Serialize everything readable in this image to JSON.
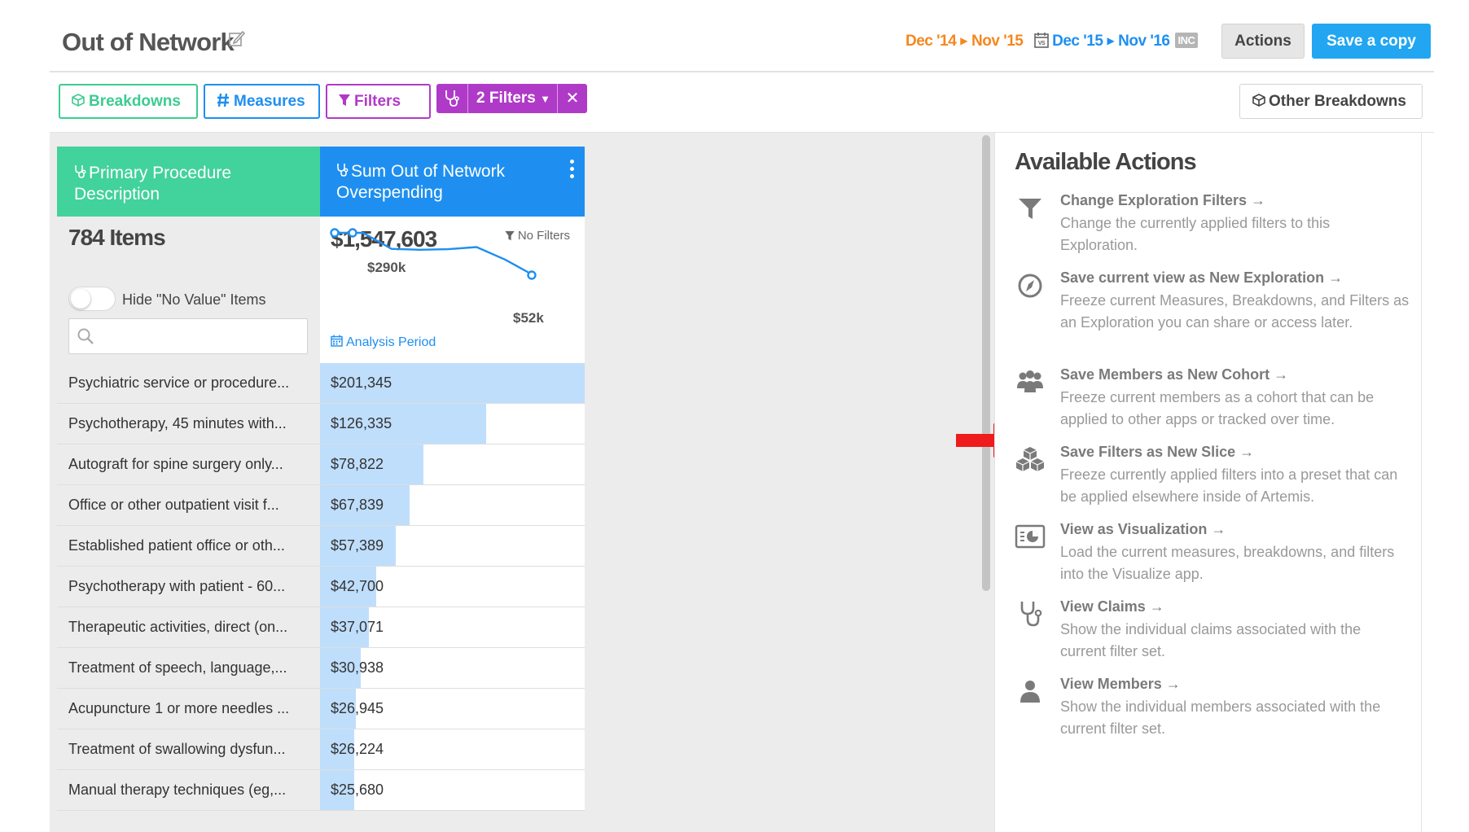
{
  "header": {
    "title": "Out of Network",
    "date_range_1": {
      "start": "Dec '14",
      "end": "Nov '15"
    },
    "date_range_2": {
      "start": "Dec '15",
      "end": "Nov '16"
    },
    "inc_badge": "INC",
    "actions_label": "Actions",
    "save_copy_label": "Save a copy"
  },
  "toolbar": {
    "breakdowns_label": "Breakdowns",
    "measures_label": "Measures",
    "filters_label": "Filters",
    "filter_count_label": "2 Filters",
    "close_glyph": "✕",
    "other_breakdowns_label": "Other Breakdowns"
  },
  "table": {
    "col1_header": "Primary Procedure Description",
    "col2_header": "Sum Out of Network Overspending",
    "items_count": "784 Items",
    "hide_no_value_label": "Hide \"No Value\" Items",
    "search_placeholder": "",
    "total": "$1,547,603",
    "no_filters_label": "No Filters",
    "spark_max_label": "$290k",
    "spark_min_label": "$52k",
    "analysis_period_label": "Analysis Period",
    "sparkline_values": [
      290,
      290,
      200,
      195,
      198,
      210,
      140,
      52
    ],
    "rows": [
      {
        "label": "Psychiatric service or procedure...",
        "value": "$201,345",
        "amount": 201345
      },
      {
        "label": "Psychotherapy, 45 minutes with...",
        "value": "$126,335",
        "amount": 126335
      },
      {
        "label": "Autograft for spine surgery only...",
        "value": "$78,822",
        "amount": 78822
      },
      {
        "label": "Office or other outpatient visit f...",
        "value": "$67,839",
        "amount": 67839
      },
      {
        "label": "Established patient office or oth...",
        "value": "$57,389",
        "amount": 57389
      },
      {
        "label": "Psychotherapy with patient - 60...",
        "value": "$42,700",
        "amount": 42700
      },
      {
        "label": "Therapeutic activities, direct (on...",
        "value": "$37,071",
        "amount": 37071
      },
      {
        "label": "Treatment of speech, language,...",
        "value": "$30,938",
        "amount": 30938
      },
      {
        "label": "Acupuncture 1 or more needles ...",
        "value": "$26,945",
        "amount": 26945
      },
      {
        "label": "Treatment of swallowing dysfun...",
        "value": "$26,224",
        "amount": 26224
      },
      {
        "label": "Manual therapy techniques (eg,...",
        "value": "$25,680",
        "amount": 25680
      }
    ]
  },
  "actions_panel": {
    "title": "Available Actions",
    "items": [
      {
        "icon": "funnel-icon",
        "title": "Change Exploration Filters →",
        "desc": "Change the currently applied filters to this Exploration."
      },
      {
        "icon": "compass-icon",
        "title": "Save current view as New Exploration →",
        "desc": "Freeze current Measures, Breakdowns, and Filters as an Exploration you can share or access later."
      },
      {
        "icon": "group-icon",
        "title": "Save Members as New Cohort →",
        "desc": "Freeze current members as a cohort that can be applied to other apps or tracked over time."
      },
      {
        "icon": "cubes-icon",
        "title": "Save Filters as New Slice →",
        "desc": "Freeze currently applied filters into a preset that can be applied elsewhere inside of Artemis."
      },
      {
        "icon": "chart-icon",
        "title": "View as Visualization →",
        "desc": "Load the current measures, breakdowns, and filters into the Visualize app."
      },
      {
        "icon": "stethoscope-icon",
        "title": "View Claims →",
        "desc": "Show the individual claims associated with the current filter set."
      },
      {
        "icon": "user-icon",
        "title": "View Members →",
        "desc": "Show the individual members associated with the current filter set."
      }
    ]
  },
  "colors": {
    "green": "#42d29b",
    "blue": "#1e8ff0",
    "purple": "#b03ac8",
    "orange": "#f5871f",
    "bar": "#bfdefc"
  }
}
